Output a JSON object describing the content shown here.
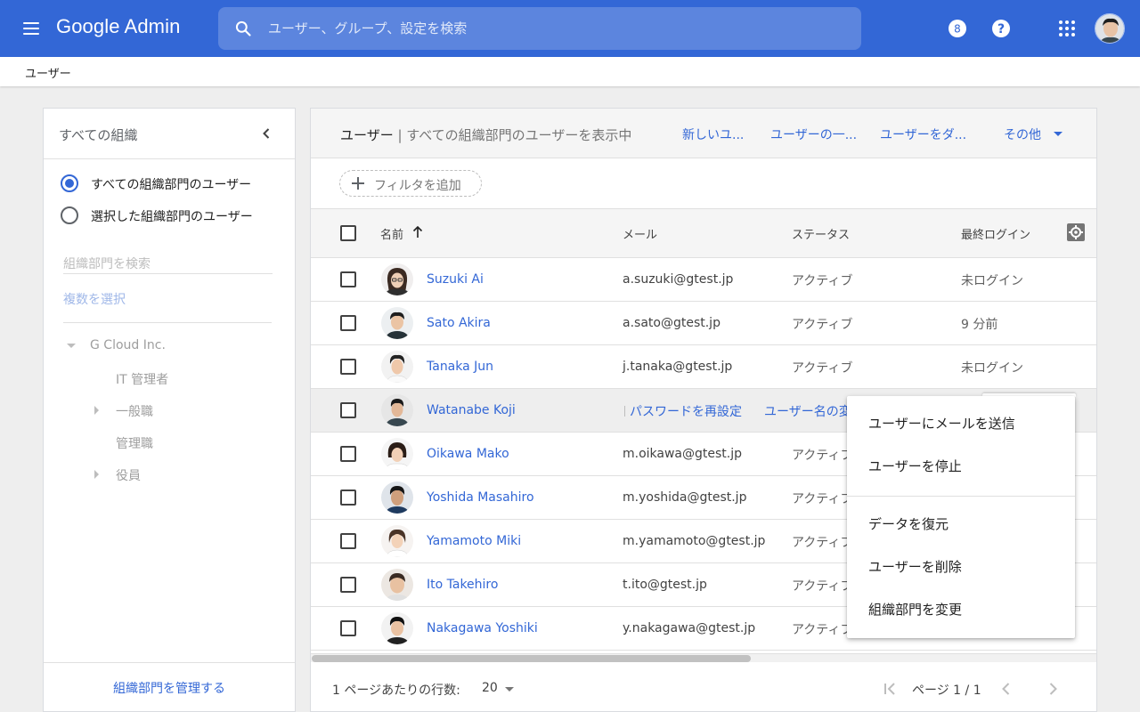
{
  "topbar": {
    "app_name": "Google Admin",
    "search_placeholder": "ユーザー、グループ、設定を検索",
    "icons": [
      "menu-icon",
      "search-icon",
      "support-icon",
      "help-icon",
      "apps-icon",
      "account-avatar"
    ],
    "bg_color": "#3367d6"
  },
  "breadcrumb": "ユーザー",
  "sidebar": {
    "title": "すべての組織",
    "radios": [
      {
        "label": "すべての組織部門のユーザー",
        "checked": true
      },
      {
        "label": "選択した組織部門のユーザー",
        "checked": false
      }
    ],
    "search_placeholder": "組織部門を検索",
    "multi_select": "複数を選択",
    "tree": {
      "root": "G Cloud Inc.",
      "children": [
        "IT 管理者",
        "一般職",
        "管理職",
        "役員"
      ]
    },
    "manage_link": "組織部門を管理する"
  },
  "main": {
    "title_bold": "ユーザー",
    "title_rest": " | すべての組織部門のユーザーを表示中",
    "actions": [
      "新しいユ...",
      "ユーザーの一...",
      "ユーザーをダ...",
      "その他"
    ],
    "filter_label": "フィルタを追加",
    "columns": {
      "name": "名前",
      "email": "メール",
      "status": "ステータス",
      "last_login": "最終ログイン"
    },
    "rows": [
      {
        "name": "Suzuki Ai",
        "email": "a.suzuki@gtest.jp",
        "status": "アクティブ",
        "last_login": "未ログイン"
      },
      {
        "name": "Sato Akira",
        "email": "a.sato@gtest.jp",
        "status": "アクティブ",
        "last_login": "9 分前"
      },
      {
        "name": "Tanaka Jun",
        "email": "j.tanaka@gtest.jp",
        "status": "アクティブ",
        "last_login": "未ログイン"
      },
      {
        "name": "Watanabe Koji",
        "email": "",
        "status": "",
        "last_login": ""
      },
      {
        "name": "Oikawa Mako",
        "email": "m.oikawa@gtest.jp",
        "status": "アクティブ",
        "last_login": ""
      },
      {
        "name": "Yoshida Masahiro",
        "email": "m.yoshida@gtest.jp",
        "status": "アクティブ",
        "last_login": ""
      },
      {
        "name": "Yamamoto Miki",
        "email": "m.yamamoto@gtest.jp",
        "status": "アクティブ",
        "last_login": ""
      },
      {
        "name": "Ito Takehiro",
        "email": "t.ito@gtest.jp",
        "status": "アクティブ",
        "last_login": ""
      },
      {
        "name": "Nakagawa Yoshiki",
        "email": "y.nakagawa@gtest.jp",
        "status": "アクティブ",
        "last_login": ""
      }
    ],
    "hover_actions": [
      "パスワードを再設定",
      "ユーザー名の変"
    ],
    "pager": {
      "rows_label": "1 ページあたりの行数:",
      "rows_value": "20",
      "page_info": "ページ 1 / 1"
    }
  },
  "context_menu": {
    "items": [
      "ユーザーにメールを送信",
      "ユーザーを停止",
      "データを復元",
      "ユーザーを削除",
      "組織部門を変更"
    ]
  }
}
